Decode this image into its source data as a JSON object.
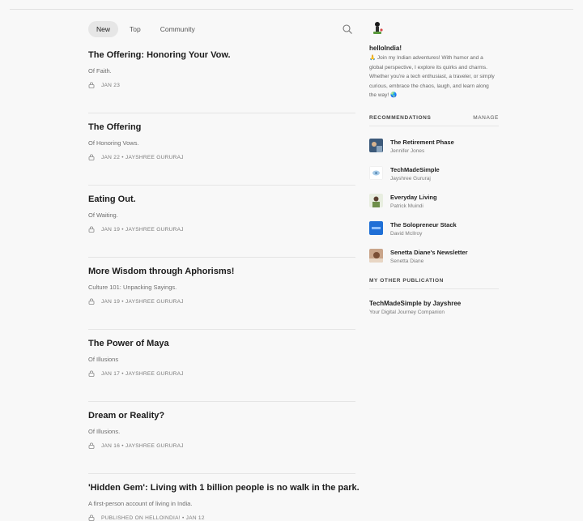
{
  "tabs": [
    {
      "label": "New",
      "active": true
    },
    {
      "label": "Top",
      "active": false
    },
    {
      "label": "Community",
      "active": false
    }
  ],
  "icons": {
    "search": "search-icon",
    "lock": "lock-icon"
  },
  "posts": [
    {
      "title": "The Offering: Honoring Your Vow.",
      "subtitle": "Of Faith.",
      "meta": "JAN 23"
    },
    {
      "title": "The Offering",
      "subtitle": "Of Honoring Vows.",
      "meta": "JAN 22 • JAYSHREE GURURAJ"
    },
    {
      "title": "Eating Out.",
      "subtitle": "Of Waiting.",
      "meta": "JAN 19 • JAYSHREE GURURAJ"
    },
    {
      "title": "More Wisdom through Aphorisms!",
      "subtitle": "Culture 101: Unpacking Sayings.",
      "meta": "JAN 19 • JAYSHREE GURURAJ"
    },
    {
      "title": "The Power of Maya",
      "subtitle": "Of Illusions",
      "meta": "JAN 17 • JAYSHREE GURURAJ"
    },
    {
      "title": "Dream or Reality?",
      "subtitle": "Of Illusions.",
      "meta": "JAN 16 • JAYSHREE GURURAJ"
    },
    {
      "title": "'Hidden Gem': Living with 1 billion people is no walk in the park.",
      "subtitle": "A first-person account of living in India.",
      "meta": "PUBLISHED ON HELLOINDIA! • JAN 12"
    }
  ],
  "publication": {
    "name": "helloIndia!",
    "description": "🙏 Join my Indian adventures! With humor and a global perspective, I explore its quirks and charms. Whether you're a tech enthusiast, a traveler, or simply curious, embrace the chaos, laugh, and learn along the way! 🌏"
  },
  "recommendations": {
    "heading": "RECOMMENDATIONS",
    "manage_label": "MANAGE",
    "items": [
      {
        "name": "The Retirement Phase",
        "author": "Jennifer Jones"
      },
      {
        "name": "TechMadeSimple",
        "author": "Jayshree Gururaj"
      },
      {
        "name": "Everyday Living",
        "author": "Patrick Muindi"
      },
      {
        "name": "The Solopreneur Stack",
        "author": "David McIlroy"
      },
      {
        "name": "Senetta Diane's Newsletter",
        "author": "Senetta Diane"
      }
    ]
  },
  "other_publication": {
    "heading": "MY OTHER PUBLICATION",
    "name": "TechMadeSimple by Jayshree",
    "subtitle": "Your Digital Journey Companion"
  },
  "colors": {
    "background": "#f8f8f8",
    "active_tab": "#e6e6e6",
    "text": "#222222"
  }
}
